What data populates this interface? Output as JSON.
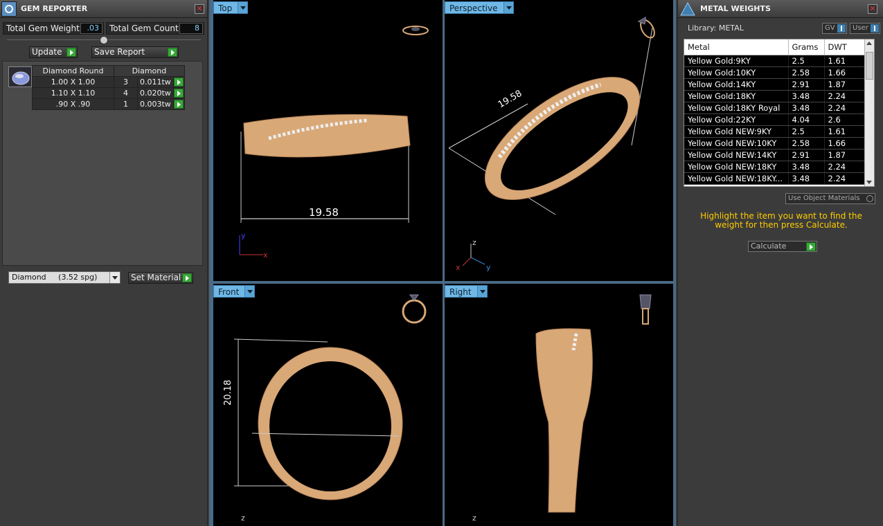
{
  "gem_reporter": {
    "title": "GEM REPORTER",
    "total_gem_weight_label": "Total Gem Weight",
    "total_gem_weight_value": ".03",
    "total_gem_count_label": "Total Gem Count",
    "total_gem_count_value": "8",
    "update_label": "Update",
    "save_report_label": "Save Report",
    "table_headers": [
      "Diamond Round",
      "Diamond"
    ],
    "rows": [
      {
        "size": "1.00 X 1.00",
        "count": "3",
        "weight": "0.011tw"
      },
      {
        "size": "1.10 X 1.10",
        "count": "4",
        "weight": "0.020tw"
      },
      {
        "size": ".90 X .90",
        "count": "1",
        "weight": "0.003tw"
      }
    ],
    "material_select": "Diamond     (3.52 spg)",
    "set_material_label": "Set Material"
  },
  "viewports": {
    "top": {
      "label": "Top",
      "dimension": "19.58"
    },
    "perspective": {
      "label": "Perspective",
      "dimension": "19.58"
    },
    "front": {
      "label": "Front",
      "dimension": "20.18"
    },
    "right": {
      "label": "Right"
    }
  },
  "metal_weights": {
    "title": "METAL WEIGHTS",
    "library_label": "Library: METAL",
    "gv_label": "GV",
    "user_label": "User",
    "columns": [
      "Metal",
      "Grams",
      "DWT"
    ],
    "rows": [
      {
        "metal": "Yellow Gold:9KY",
        "grams": "2.5",
        "dwt": "1.61"
      },
      {
        "metal": "Yellow Gold:10KY",
        "grams": "2.58",
        "dwt": "1.66"
      },
      {
        "metal": "Yellow Gold:14KY",
        "grams": "2.91",
        "dwt": "1.87"
      },
      {
        "metal": "Yellow Gold:18KY",
        "grams": "3.48",
        "dwt": "2.24"
      },
      {
        "metal": "Yellow Gold:18KY Royal",
        "grams": "3.48",
        "dwt": "2.24"
      },
      {
        "metal": "Yellow Gold:22KY",
        "grams": "4.04",
        "dwt": "2.6"
      },
      {
        "metal": "Yellow Gold NEW:9KY",
        "grams": "2.5",
        "dwt": "1.61"
      },
      {
        "metal": "Yellow Gold NEW:10KY",
        "grams": "2.58",
        "dwt": "1.66"
      },
      {
        "metal": "Yellow Gold NEW:14KY",
        "grams": "2.91",
        "dwt": "1.87"
      },
      {
        "metal": "Yellow Gold NEW:18KY",
        "grams": "3.48",
        "dwt": "2.24"
      },
      {
        "metal": "Yellow Gold NEW:18KY...",
        "grams": "3.48",
        "dwt": "2.24"
      }
    ],
    "use_object_materials_label": "Use Object Materials",
    "hint": "Highlight the item you want to find the weight for then press Calculate.",
    "calculate_label": "Calculate"
  },
  "colors": {
    "gold": "#d9a877",
    "accent_blue": "#6fb8e6",
    "hint_yellow": "#ffcc00",
    "go_green": "#3aa83a"
  }
}
